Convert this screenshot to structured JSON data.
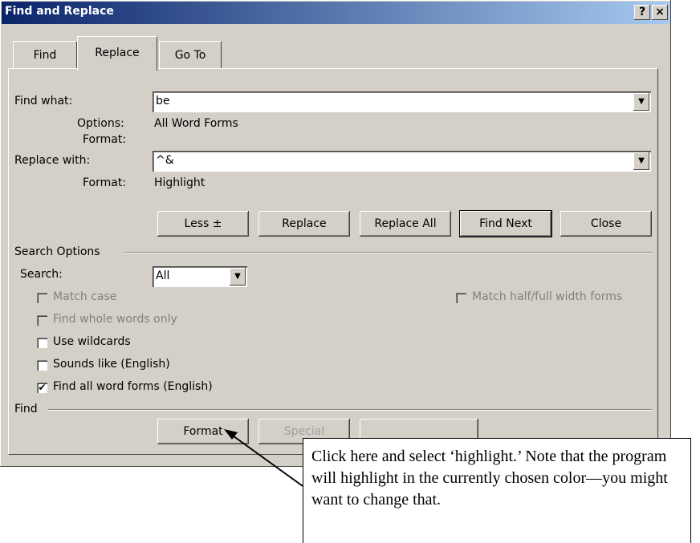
{
  "title": "Find and Replace",
  "title_buttons": {
    "help": "?",
    "close": "×"
  },
  "tabs": [
    {
      "label": "Find"
    },
    {
      "label": "Replace"
    },
    {
      "label": "Go To"
    }
  ],
  "find": {
    "label": "Find what:",
    "value": "be",
    "options_label": "Options:",
    "options_value": "All Word Forms",
    "format_label": "Format:"
  },
  "replace": {
    "label": "Replace with:",
    "value": "^&",
    "format_label": "Format:",
    "format_value": "Highlight"
  },
  "buttons": {
    "less": "Less ±",
    "replace": "Replace",
    "replace_all": "Replace All",
    "find_next": "Find Next",
    "close": "Close"
  },
  "search_options": {
    "header": "Search Options",
    "search_label": "Search:",
    "search_value": "All",
    "match_case": "Match case",
    "whole_words": "Find whole words only",
    "wildcards": "Use wildcards",
    "sounds_like": "Sounds like (English)",
    "all_forms": "Find all word forms (English)",
    "half_full": "Match half/full width forms"
  },
  "find_section": {
    "header": "Find",
    "format_button": "Format",
    "special_button": "Special"
  },
  "annotation": "Click here and select ‘highlight.’ Note that the program will highlight in the currently chosen color—you might want to change that."
}
